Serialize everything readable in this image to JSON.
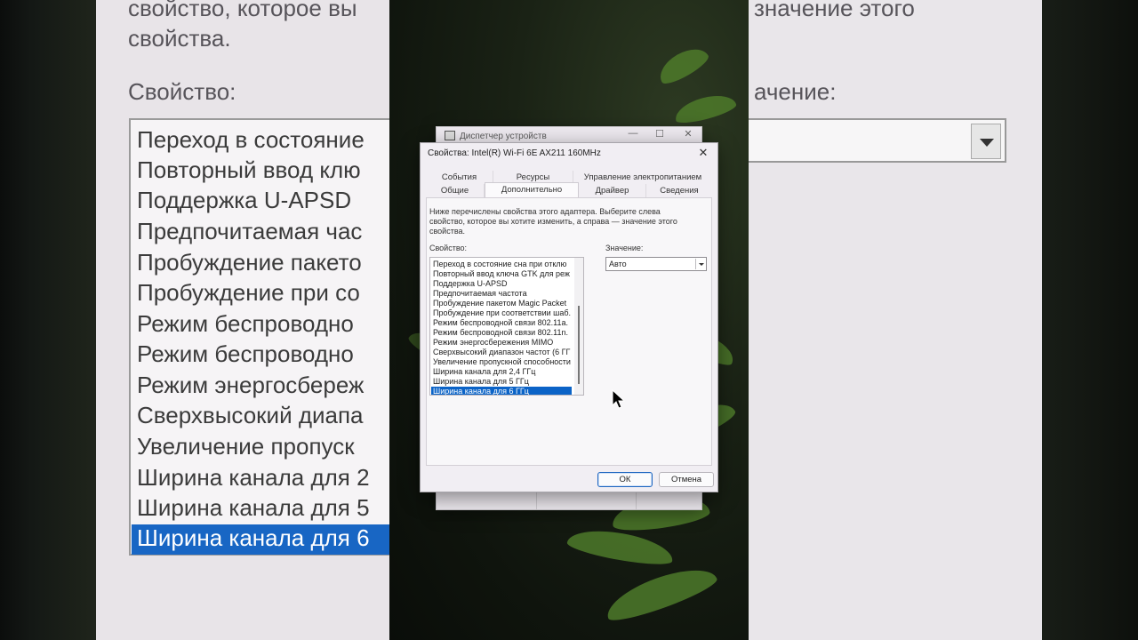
{
  "background_zoom": {
    "left_text_lines": [
      "свойство, которое вы",
      "свойства.",
      "Свойство:"
    ],
    "left_list_rows": [
      "Переход в состояние",
      "Повторный ввод клю",
      "Поддержка U-APSD",
      "Предпочитаемая час",
      "Пробуждение пакето",
      "Пробуждение при со",
      "Режим беспроводно",
      "Режим беспроводно",
      "Режим энергосбереж",
      "Сверхвысокий диапа",
      "Увеличение пропуск",
      "Ширина канала для 2",
      "Ширина канала для 5",
      "Ширина канала для 6"
    ],
    "right_text_lines": [
      "значение этого",
      "ачение:"
    ]
  },
  "device_manager": {
    "title": "Диспетчер устройств",
    "minimize": "—",
    "maximize": "☐",
    "close": "✕"
  },
  "dialog": {
    "title": "Свойства: Intel(R) Wi-Fi 6E AX211 160MHz",
    "close": "✕",
    "tabs_row1": [
      "События",
      "Ресурсы",
      "Управление электропитанием"
    ],
    "tabs_row2": [
      "Общие",
      "Дополнительно",
      "Драйвер",
      "Сведения"
    ],
    "active_tab": "Дополнительно",
    "description": "Ниже перечислены свойства этого адаптера. Выберите слева свойство, которое вы хотите изменить, а справа — значение этого свойства.",
    "property_label": "Свойство:",
    "value_label": "Значение:",
    "properties": [
      "Переход в состояние сна при отклю",
      "Повторный ввод ключа GTK для реж",
      "Поддержка U-APSD",
      "Предпочитаемая частота",
      "Пробуждение пакетом Magic Packet",
      "Пробуждение при соответствии шаб.",
      "Режим беспроводной связи 802.11a.",
      "Режим беспроводной связи 802.11n.",
      "Режим энергосбережения MIMO",
      "Сверхвысокий диапазон частот (6 ГГ",
      "Увеличение пропускной способности",
      "Ширина канала для 2,4 ГГц",
      "Ширина канала для 5 ГГц",
      "Ширина канала для 6 ГГц"
    ],
    "selected_property_index": 13,
    "value": "Авто",
    "ok_label": "ОК",
    "cancel_label": "Отмена"
  },
  "colors": {
    "selection": "#0b63c7",
    "dialog_bg": "#f1eef3"
  }
}
